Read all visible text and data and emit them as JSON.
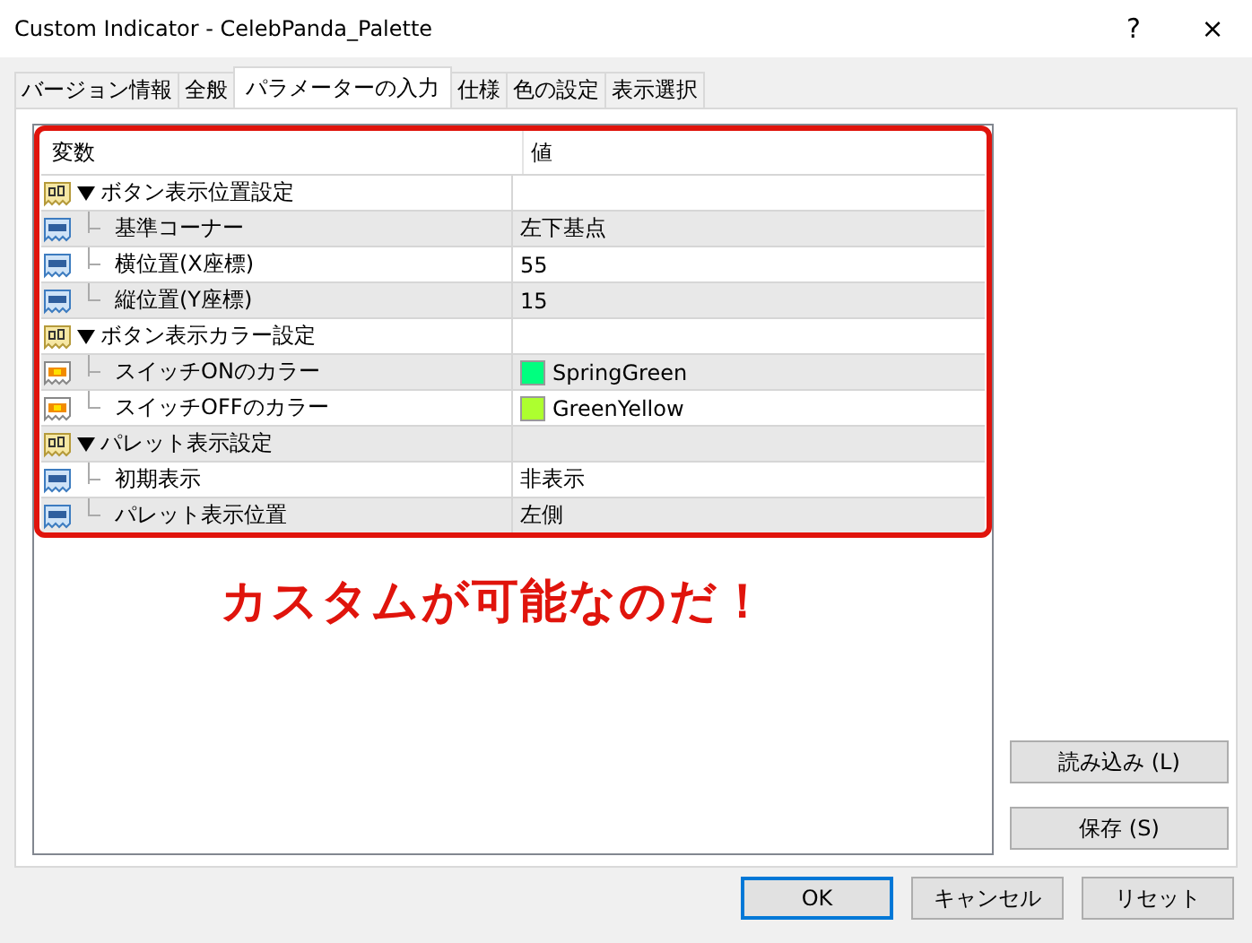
{
  "window": {
    "title": "Custom Indicator - CelebPanda_Palette",
    "help": "?",
    "close": "×"
  },
  "tabs": [
    {
      "label": "バージョン情報",
      "selected": false
    },
    {
      "label": "全般",
      "selected": false
    },
    {
      "label": "パラメーターの入力",
      "selected": true
    },
    {
      "label": "仕様",
      "selected": false
    },
    {
      "label": "色の設定",
      "selected": false
    },
    {
      "label": "表示選択",
      "selected": false
    }
  ],
  "table": {
    "columns": [
      "変数",
      "値"
    ],
    "rows": [
      {
        "kind": "group",
        "name": "ボタン表示位置設定",
        "expanded": true,
        "children": [
          {
            "kind": "number",
            "name": "基準コーナー",
            "value": "左下基点"
          },
          {
            "kind": "number",
            "name": "横位置(X座標)",
            "value": "55"
          },
          {
            "kind": "number",
            "name": "縦位置(Y座標)",
            "value": "15"
          }
        ]
      },
      {
        "kind": "group",
        "name": "ボタン表示カラー設定",
        "expanded": true,
        "children": [
          {
            "kind": "color",
            "name": "スイッチONのカラー",
            "value": "SpringGreen",
            "color": "#00ff7f"
          },
          {
            "kind": "color",
            "name": "スイッチOFFのカラー",
            "value": "GreenYellow",
            "color": "#adff2f"
          }
        ]
      },
      {
        "kind": "group",
        "name": "パレット表示設定",
        "expanded": true,
        "children": [
          {
            "kind": "number",
            "name": "初期表示",
            "value": "非表示"
          },
          {
            "kind": "number",
            "name": "パレット表示位置",
            "value": "左側"
          }
        ]
      }
    ]
  },
  "annotation": "カスタムが可能なのだ！",
  "side_buttons": [
    "読み込み (L)",
    "保存 (S)"
  ],
  "buttons": [
    {
      "label": "OK",
      "default": true
    },
    {
      "label": "キャンセル",
      "default": false
    },
    {
      "label": "リセット",
      "default": false
    }
  ]
}
